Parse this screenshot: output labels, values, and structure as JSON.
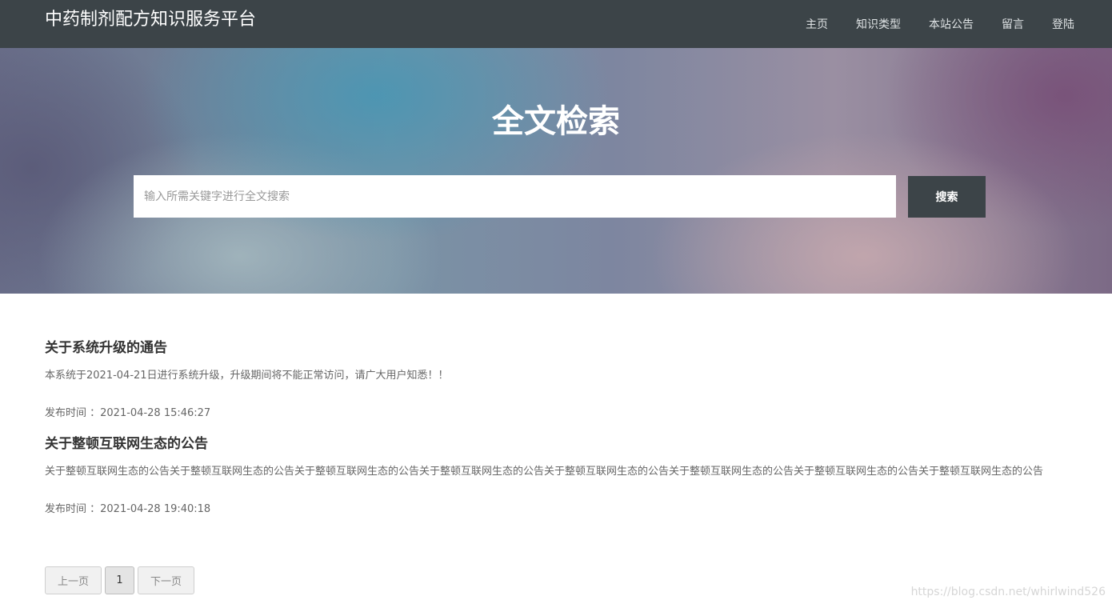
{
  "header": {
    "brand": "中药制剂配方知识服务平台",
    "nav": [
      "主页",
      "知识类型",
      "本站公告",
      "留言",
      "登陆"
    ]
  },
  "hero": {
    "title": "全文检索",
    "search_placeholder": "输入所需关键字进行全文搜索",
    "search_button": "搜索"
  },
  "notices": [
    {
      "title": "关于系统升级的通告",
      "body": "本系统于2021-04-21日进行系统升级，升级期间将不能正常访问，请广大用户知悉！！",
      "time": "发布时间 ：2021-04-28 15:46:27"
    },
    {
      "title": "关于整顿互联网生态的公告",
      "body": "关于整顿互联网生态的公告关于整顿互联网生态的公告关于整顿互联网生态的公告关于整顿互联网生态的公告关于整顿互联网生态的公告关于整顿互联网生态的公告关于整顿互联网生态的公告关于整顿互联网生态的公告",
      "time": "发布时间 ：2021-04-28 19:40:18"
    }
  ],
  "pagination": {
    "prev": "上一页",
    "current": "1",
    "next": "下一页"
  },
  "watermark": "https://blog.csdn.net/whirlwind526"
}
